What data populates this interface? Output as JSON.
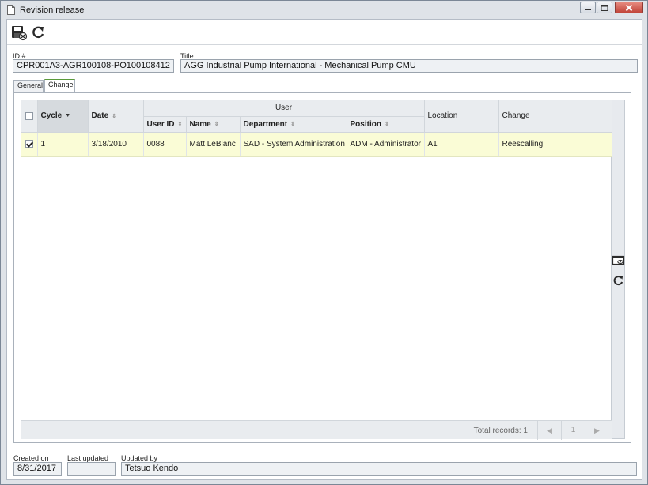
{
  "window": {
    "title": "Revision release"
  },
  "fields": {
    "id_label": "ID #",
    "id_value": "CPR001A3-AGR100108-PO100108412",
    "title_label": "Title",
    "title_value": "AGG Industrial Pump International - Mechanical Pump CMU"
  },
  "tabs": [
    {
      "label": "General"
    },
    {
      "label": "Change"
    }
  ],
  "grid": {
    "group_header_user": "User",
    "columns": {
      "cycle": "Cycle",
      "date": "Date",
      "user_id": "User ID",
      "name": "Name",
      "department": "Department",
      "position": "Position",
      "location": "Location",
      "change": "Change"
    },
    "rows": [
      {
        "checked": true,
        "cycle": "1",
        "date": "3/18/2010",
        "user_id": "0088",
        "name": "Matt LeBlanc",
        "department": "SAD - System Administration",
        "position": "ADM - Administrator",
        "location": "A1",
        "change": "Reescalling"
      }
    ],
    "total_records": "Total records: 1",
    "page": "1"
  },
  "bottom": {
    "created_label": "Created on",
    "created_value": "8/31/2017",
    "updated_label": "Last updated",
    "updated_value": "",
    "updated_by_label": "Updated by",
    "updated_by_value": "Tetsuo Kendo"
  },
  "icons": {
    "window": "document-icon",
    "save": "save-close-icon",
    "refresh": "refresh-icon",
    "view": "view-record-icon"
  }
}
